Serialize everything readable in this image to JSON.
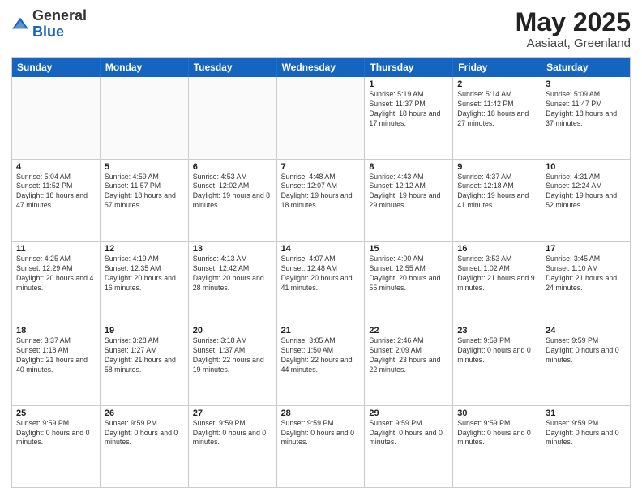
{
  "logo": {
    "general": "General",
    "blue": "Blue"
  },
  "title": {
    "month": "May 2025",
    "location": "Aasiaat, Greenland"
  },
  "header_days": [
    "Sunday",
    "Monday",
    "Tuesday",
    "Wednesday",
    "Thursday",
    "Friday",
    "Saturday"
  ],
  "weeks": [
    [
      {
        "day": "",
        "info": ""
      },
      {
        "day": "",
        "info": ""
      },
      {
        "day": "",
        "info": ""
      },
      {
        "day": "",
        "info": ""
      },
      {
        "day": "1",
        "info": "Sunrise: 5:19 AM\nSunset: 11:37 PM\nDaylight: 18 hours and 17 minutes."
      },
      {
        "day": "2",
        "info": "Sunrise: 5:14 AM\nSunset: 11:42 PM\nDaylight: 18 hours and 27 minutes."
      },
      {
        "day": "3",
        "info": "Sunrise: 5:09 AM\nSunset: 11:47 PM\nDaylight: 18 hours and 37 minutes."
      }
    ],
    [
      {
        "day": "4",
        "info": "Sunrise: 5:04 AM\nSunset: 11:52 PM\nDaylight: 18 hours and 47 minutes."
      },
      {
        "day": "5",
        "info": "Sunrise: 4:59 AM\nSunset: 11:57 PM\nDaylight: 18 hours and 57 minutes."
      },
      {
        "day": "6",
        "info": "Sunrise: 4:53 AM\nSunset: 12:02 AM\nDaylight: 19 hours and 8 minutes."
      },
      {
        "day": "7",
        "info": "Sunrise: 4:48 AM\nSunset: 12:07 AM\nDaylight: 19 hours and 18 minutes."
      },
      {
        "day": "8",
        "info": "Sunrise: 4:43 AM\nSunset: 12:12 AM\nDaylight: 19 hours and 29 minutes."
      },
      {
        "day": "9",
        "info": "Sunrise: 4:37 AM\nSunset: 12:18 AM\nDaylight: 19 hours and 41 minutes."
      },
      {
        "day": "10",
        "info": "Sunrise: 4:31 AM\nSunset: 12:24 AM\nDaylight: 19 hours and 52 minutes."
      }
    ],
    [
      {
        "day": "11",
        "info": "Sunrise: 4:25 AM\nSunset: 12:29 AM\nDaylight: 20 hours and 4 minutes."
      },
      {
        "day": "12",
        "info": "Sunrise: 4:19 AM\nSunset: 12:35 AM\nDaylight: 20 hours and 16 minutes."
      },
      {
        "day": "13",
        "info": "Sunrise: 4:13 AM\nSunset: 12:42 AM\nDaylight: 20 hours and 28 minutes."
      },
      {
        "day": "14",
        "info": "Sunrise: 4:07 AM\nSunset: 12:48 AM\nDaylight: 20 hours and 41 minutes."
      },
      {
        "day": "15",
        "info": "Sunrise: 4:00 AM\nSunset: 12:55 AM\nDaylight: 20 hours and 55 minutes."
      },
      {
        "day": "16",
        "info": "Sunrise: 3:53 AM\nSunset: 1:02 AM\nDaylight: 21 hours and 9 minutes."
      },
      {
        "day": "17",
        "info": "Sunrise: 3:45 AM\nSunset: 1:10 AM\nDaylight: 21 hours and 24 minutes."
      }
    ],
    [
      {
        "day": "18",
        "info": "Sunrise: 3:37 AM\nSunset: 1:18 AM\nDaylight: 21 hours and 40 minutes."
      },
      {
        "day": "19",
        "info": "Sunrise: 3:28 AM\nSunset: 1:27 AM\nDaylight: 21 hours and 58 minutes."
      },
      {
        "day": "20",
        "info": "Sunrise: 3:18 AM\nSunset: 1:37 AM\nDaylight: 22 hours and 19 minutes."
      },
      {
        "day": "21",
        "info": "Sunrise: 3:05 AM\nSunset: 1:50 AM\nDaylight: 22 hours and 44 minutes."
      },
      {
        "day": "22",
        "info": "Sunrise: 2:46 AM\nSunset: 2:09 AM\nDaylight: 23 hours and 22 minutes."
      },
      {
        "day": "23",
        "info": "Sunset: 9:59 PM\nDaylight: 0 hours and 0 minutes."
      },
      {
        "day": "24",
        "info": "Sunset: 9:59 PM\nDaylight: 0 hours and 0 minutes."
      }
    ],
    [
      {
        "day": "25",
        "info": "Sunset: 9:59 PM\nDaylight: 0 hours and 0 minutes."
      },
      {
        "day": "26",
        "info": "Sunset: 9:59 PM\nDaylight: 0 hours and 0 minutes."
      },
      {
        "day": "27",
        "info": "Sunset: 9:59 PM\nDaylight: 0 hours and 0 minutes."
      },
      {
        "day": "28",
        "info": "Sunset: 9:59 PM\nDaylight: 0 hours and 0 minutes."
      },
      {
        "day": "29",
        "info": "Sunset: 9:59 PM\nDaylight: 0 hours and 0 minutes."
      },
      {
        "day": "30",
        "info": "Sunset: 9:59 PM\nDaylight: 0 hours and 0 minutes."
      },
      {
        "day": "31",
        "info": "Sunset: 9:59 PM\nDaylight: 0 hours and 0 minutes."
      }
    ]
  ]
}
